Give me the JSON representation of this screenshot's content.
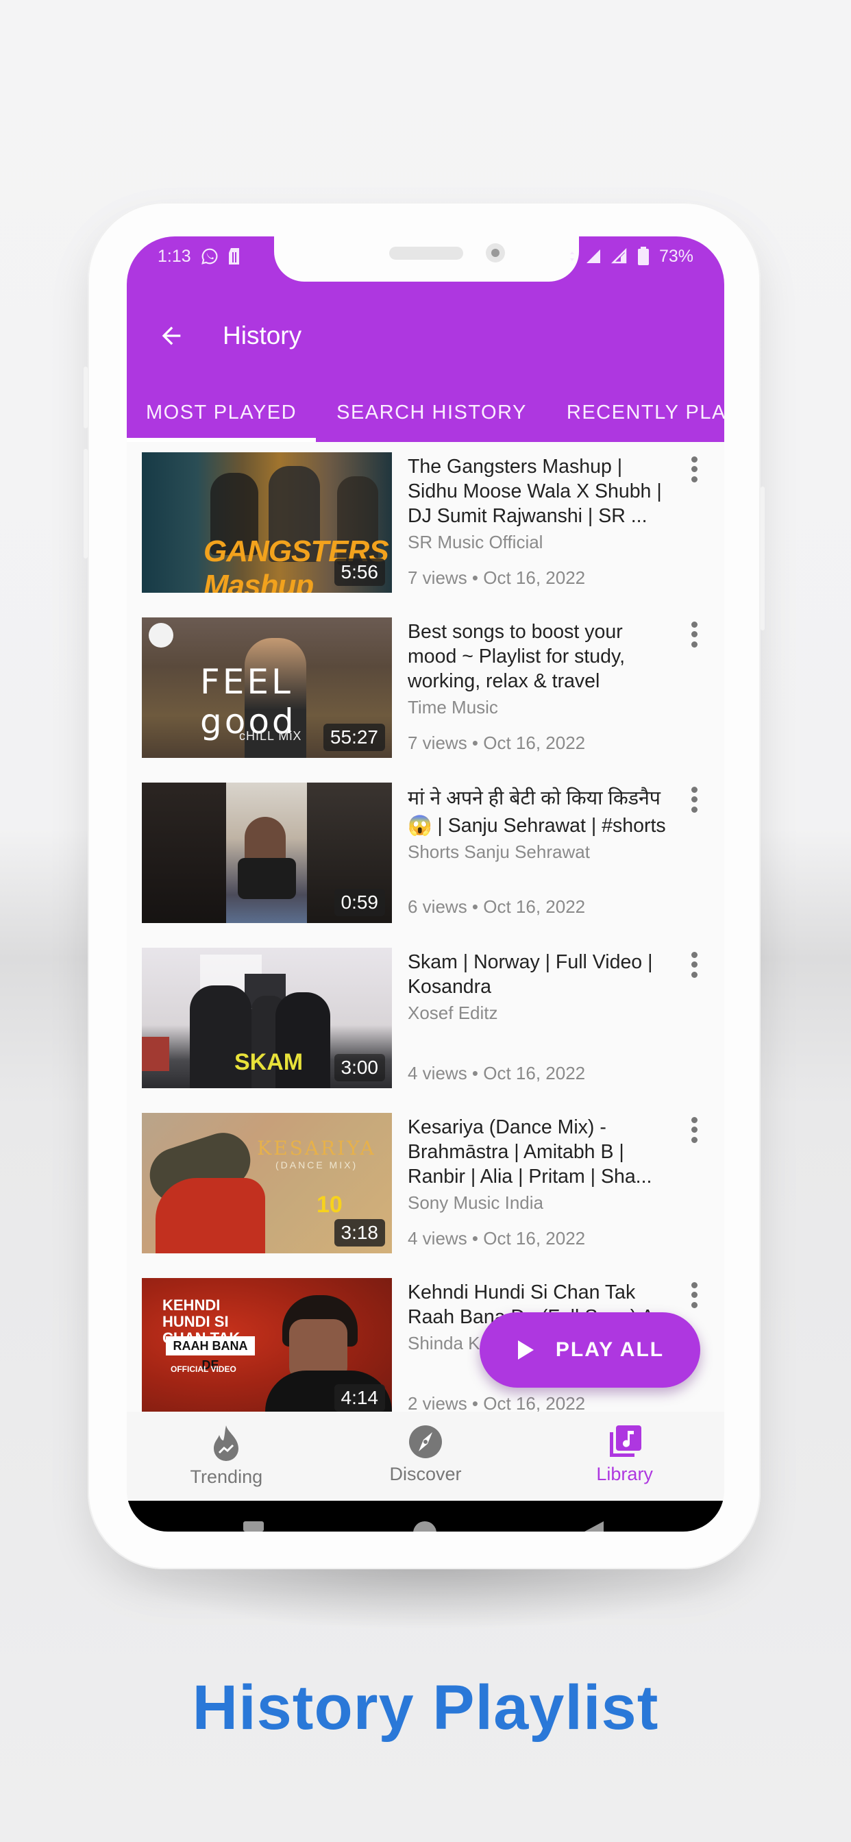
{
  "status_bar": {
    "time": "1:13",
    "left_icons": [
      "whatsapp-icon",
      "sim-storage-icon"
    ],
    "right_icons": [
      "data-arrows-icon",
      "signal-icon",
      "signal-empty-icon",
      "battery-icon"
    ],
    "battery": "73%"
  },
  "app_bar": {
    "back_icon": "arrow-left-icon",
    "title": "History"
  },
  "tabs": [
    {
      "label": "MOST PLAYED",
      "active": true
    },
    {
      "label": "SEARCH HISTORY",
      "active": false
    },
    {
      "label": "RECENTLY PLAYED",
      "active": false
    }
  ],
  "videos": [
    {
      "title": "The Gangsters Mashup | Sidhu Moose Wala X Shubh | DJ Sumit Rajwanshi | SR ...",
      "channel": "SR Music Official",
      "meta": "7 views • Oct 16, 2022",
      "duration": "5:56",
      "thumb_text": "GANGSTERS Mashup"
    },
    {
      "title": "Best songs to boost your mood ~ Playlist for study, working, relax & travel",
      "channel": "Time Music",
      "meta": "7 views • Oct 16, 2022",
      "duration": "55:27",
      "thumb_text": "FEEL good"
    },
    {
      "title": "मां ने अपने ही बेटी को किया किडनैप 😱 | Sanju Sehrawat | #shorts",
      "channel": "Shorts Sanju Sehrawat",
      "meta": "6 views • Oct 16, 2022",
      "duration": "0:59",
      "thumb_text": ""
    },
    {
      "title": "Skam | Norway | Full Video | Kosandra",
      "channel": "Xosef Editz",
      "meta": "4 views • Oct 16, 2022",
      "duration": "3:00",
      "thumb_text": "SKAM"
    },
    {
      "title": "Kesariya (Dance Mix) - Brahmāstra | Amitabh B | Ranbir | Alia | Pritam | Sha...",
      "channel": "Sony Music India",
      "meta": "4 views • Oct 16, 2022",
      "duration": "3:18",
      "thumb_text": "KESARIYA"
    },
    {
      "title": "Kehndi Hundi Si Chan Tak Raah Bana De (Full Song) A...",
      "channel": "Shinda Kahlon",
      "meta": "2 views • Oct 16, 2022",
      "duration": "4:14",
      "thumb_text": "KEHNDI HUNDI SI CHAN TAK"
    }
  ],
  "fab": {
    "label": "PLAY ALL",
    "icon": "play-icon"
  },
  "bottom_nav": [
    {
      "label": "Trending",
      "icon": "trending-flame-icon",
      "active": false
    },
    {
      "label": "Discover",
      "icon": "compass-icon",
      "active": false
    },
    {
      "label": "Library",
      "icon": "library-music-icon",
      "active": true
    }
  ],
  "caption": "History Playlist",
  "colors": {
    "accent": "#ae37e0",
    "caption": "#2a78d8"
  }
}
